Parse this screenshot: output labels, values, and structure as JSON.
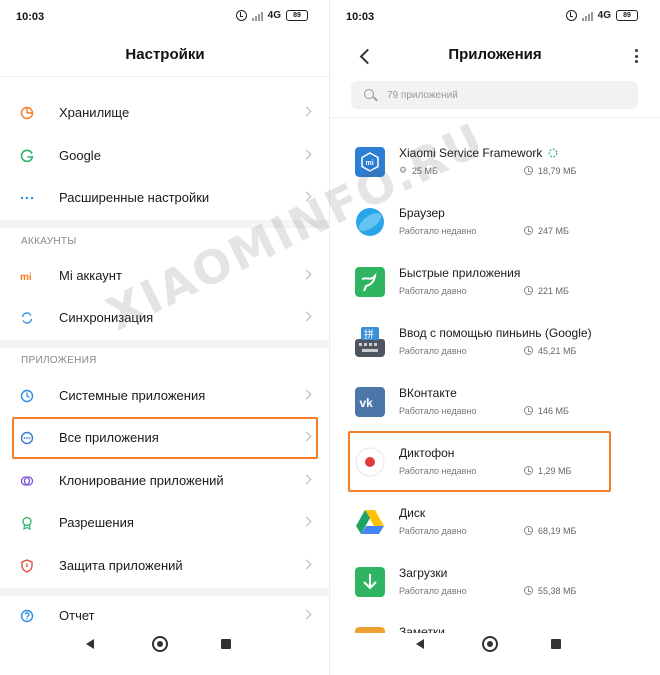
{
  "colors": {
    "highlight": "#f57c25",
    "storage_icon": "#f57c25",
    "google_icon": "#2db36b",
    "advanced_icon": "#2b8ce0",
    "mi_icon": "#f57c25",
    "sync_icon": "#2b8ce0",
    "system_apps_icon": "#2b8ce0",
    "all_apps_icon": "#3a7bd5",
    "clone_icon": "#7d55d4",
    "permissions_icon": "#2db36b",
    "protection_icon": "#e0453a",
    "report_icon": "#2b8ce0"
  },
  "left": {
    "status": {
      "time": "10:03",
      "network": "4G",
      "battery": "89"
    },
    "title": "Настройки",
    "items_top": [
      {
        "label": "Хранилище",
        "icon": "pie-chart-icon"
      },
      {
        "label": "Google",
        "icon": "google-g-icon"
      },
      {
        "label": "Расширенные настройки",
        "icon": "dots-icon"
      }
    ],
    "accounts_header": "АККАУНТЫ",
    "items_accounts": [
      {
        "label": "Mi аккаунт",
        "icon": "mi-logo-icon"
      },
      {
        "label": "Синхронизация",
        "icon": "sync-icon"
      }
    ],
    "apps_header": "ПРИЛОЖЕНИЯ",
    "items_apps": [
      {
        "label": "Системные приложения",
        "icon": "grid-icon"
      },
      {
        "label": "Все приложения",
        "icon": "more-circle-icon"
      },
      {
        "label": "Клонирование приложений",
        "icon": "clone-icon"
      },
      {
        "label": "Разрешения",
        "icon": "badge-icon"
      },
      {
        "label": "Защита приложений",
        "icon": "shield-icon"
      }
    ],
    "items_bottom": [
      {
        "label": "Отчет",
        "icon": "question-icon"
      }
    ]
  },
  "right": {
    "status": {
      "time": "10:03",
      "network": "4G",
      "battery": "89"
    },
    "title": "Приложения",
    "search_placeholder": "79 приложений",
    "apps": [
      {
        "name": "Xiaomi Service Framework",
        "status": "25 МБ",
        "size": "18,79 МБ",
        "icon": "xiaomi-framework-icon",
        "color": "#2a7fd4"
      },
      {
        "name": "Браузер",
        "status": "Работало недавно",
        "size": "247 МБ",
        "icon": "browser-icon",
        "color": "#2aa4e8"
      },
      {
        "name": "Быстрые приложения",
        "status": "Работало давно",
        "size": "221 МБ",
        "icon": "quick-apps-icon",
        "color": "#2fb462"
      },
      {
        "name": "Ввод с помощью пиньинь (Google)",
        "status": "Работало давно",
        "size": "45,21 МБ",
        "icon": "pinyin-keyboard-icon",
        "color": "#4d5561"
      },
      {
        "name": "ВКонтакте",
        "status": "Работало недавно",
        "size": "146 МБ",
        "icon": "vk-icon",
        "color": "#4a76a8"
      },
      {
        "name": "Диктофон",
        "status": "Работало недавно",
        "size": "1,29 МБ",
        "icon": "recorder-icon",
        "color": "#e23a3a"
      },
      {
        "name": "Диск",
        "status": "Работало давно",
        "size": "68,19 МБ",
        "icon": "drive-icon",
        "color": "#1fa463"
      },
      {
        "name": "Загрузки",
        "status": "Работало давно",
        "size": "55,38 МБ",
        "icon": "downloads-icon",
        "color": "#2fb462"
      },
      {
        "name": "Заметки",
        "status": "",
        "size": "",
        "icon": "notes-icon",
        "color": "#f0a030"
      }
    ]
  },
  "watermark": "XIAOMINFO.RU"
}
